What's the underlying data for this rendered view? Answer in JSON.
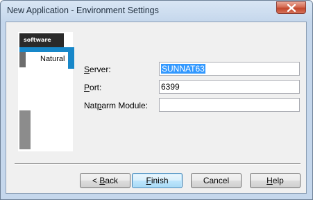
{
  "window": {
    "title": "New Application - Environment Settings"
  },
  "side_panel": {
    "logo_text": "software",
    "product": "Natural"
  },
  "fields": {
    "server": {
      "label_key": "S",
      "label_rest": "erver:",
      "value": "SUNNAT63"
    },
    "port": {
      "label_key": "P",
      "label_rest": "ort:",
      "value": "6399"
    },
    "natparm": {
      "label_pre": "Nat",
      "label_key": "p",
      "label_rest": "arm Module:",
      "value": ""
    }
  },
  "buttons": {
    "back": {
      "pre": "< ",
      "key": "B",
      "rest": "ack"
    },
    "finish": {
      "key": "F",
      "rest": "inish"
    },
    "cancel": {
      "label": "Cancel"
    },
    "help": {
      "key": "H",
      "rest": "elp"
    }
  },
  "colors": {
    "selection": "#3399ff",
    "close_button": "#c2462b",
    "accent_blue": "#1787c9"
  }
}
